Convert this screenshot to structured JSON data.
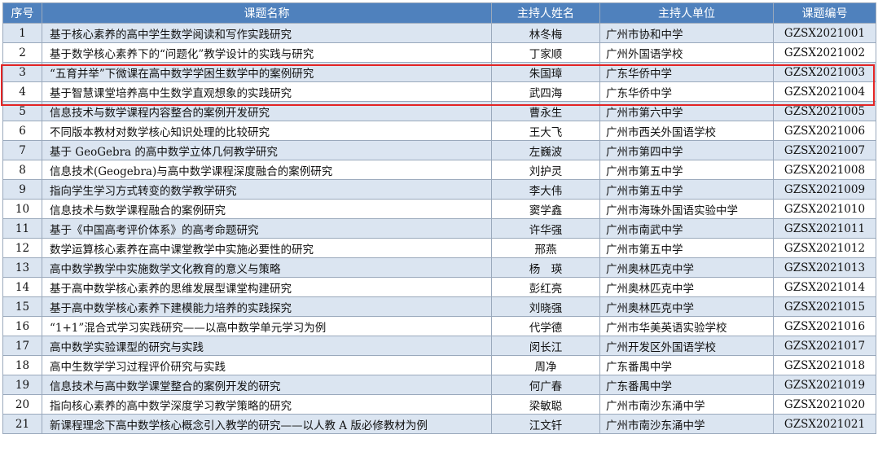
{
  "headers": [
    "序号",
    "课题名称",
    "主持人姓名",
    "主持人单位",
    "课题编号"
  ],
  "rows": [
    [
      "1",
      "基于核心素养的高中学生数学阅读和写作实践研究",
      "林冬梅",
      "广州市协和中学",
      "GZSX2021001"
    ],
    [
      "2",
      "基于数学核心素养下的“问题化”教学设计的实践与研究",
      "丁家顺",
      "广州外国语学校",
      "GZSX2021002"
    ],
    [
      "3",
      "“五育并举”下微课在高中数学学困生数学中的案例研究",
      "朱国璋",
      "广东华侨中学",
      "GZSX2021003"
    ],
    [
      "4",
      "基于智慧课堂培养高中生数学直观想象的实践研究",
      "武四海",
      "广东华侨中学",
      "GZSX2021004"
    ],
    [
      "5",
      "信息技术与数学课程内容整合的案例开发研究",
      "曹永生",
      "广州市第六中学",
      "GZSX2021005"
    ],
    [
      "6",
      "不同版本教材对数学核心知识处理的比较研究",
      "王大飞",
      "广州市西关外国语学校",
      "GZSX2021006"
    ],
    [
      "7",
      "基于 GeoGebra 的高中数学立体几何教学研究",
      "左巍波",
      "广州市第四中学",
      "GZSX2021007"
    ],
    [
      "8",
      "信息技术(Geogebra)与高中数学课程深度融合的案例研究",
      "刘护灵",
      "广州市第五中学",
      "GZSX2021008"
    ],
    [
      "9",
      "指向学生学习方式转变的数学教学研究",
      "李大伟",
      "广州市第五中学",
      "GZSX2021009"
    ],
    [
      "10",
      "信息技术与数学课程融合的案例研究",
      "窦学鑫",
      "广州市海珠外国语实验中学",
      "GZSX2021010"
    ],
    [
      "11",
      "基于《中国高考评价体系》的高考命题研究",
      "许华强",
      "广州市南武中学",
      "GZSX2021011"
    ],
    [
      "12",
      "数学运算核心素养在高中课堂教学中实施必要性的研究",
      "邢燕",
      "广州市第五中学",
      "GZSX2021012"
    ],
    [
      "13",
      "高中数学教学中实施数学文化教育的意义与策略",
      "杨　瑛",
      "广州奥林匹克中学",
      "GZSX2021013"
    ],
    [
      "14",
      "基于高中数学核心素养的思维发展型课堂构建研究",
      "彭红亮",
      "广州奥林匹克中学",
      "GZSX2021014"
    ],
    [
      "15",
      "基于高中数学核心素养下建模能力培养的实践探究",
      "刘晓强",
      "广州奥林匹克中学",
      "GZSX2021015"
    ],
    [
      "16",
      "“1+1”混合式学习实践研究——以高中数学单元学习为例",
      "代学德",
      "广州市华美英语实验学校",
      "GZSX2021016"
    ],
    [
      "17",
      "高中数学实验课型的研究与实践",
      "闵长江",
      "广州开发区外国语学校",
      "GZSX2021017"
    ],
    [
      "18",
      "高中生数学学习过程评价研究与实践",
      "周净",
      "广东番禺中学",
      "GZSX2021018"
    ],
    [
      "19",
      "信息技术与高中数学课堂整合的案例开发的研究",
      "何广春",
      "广东番禺中学",
      "GZSX2021019"
    ],
    [
      "20",
      "指向核心素养的高中数学深度学习教学策略的研究",
      "梁敏聪",
      "广州市南沙东涌中学",
      "GZSX2021020"
    ],
    [
      "21",
      "新课程理念下高中数学核心概念引入教学的研究——以人教 A 版必修教材为例",
      "江文钎",
      "广州市南沙东涌中学",
      "GZSX2021021"
    ]
  ],
  "colors": {
    "header_bg": "#4f81bd",
    "odd_row_bg": "#dbe5f1",
    "even_row_bg": "#ffffff",
    "highlight_border": "#e32424"
  }
}
